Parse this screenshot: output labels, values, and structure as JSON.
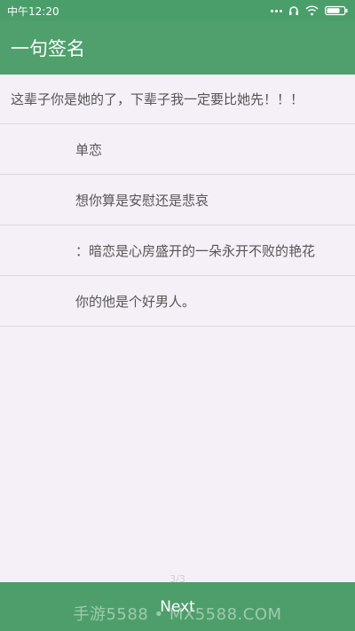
{
  "status_bar": {
    "time": "中午12:20",
    "icons": [
      "more-dots-icon",
      "headphones-icon",
      "wifi-icon",
      "battery-icon"
    ]
  },
  "app_bar": {
    "title": "一句签名"
  },
  "list": {
    "items": [
      "这辈子你是她的了，下辈子我一定要比她先！！！",
      "单恋",
      "想你算是安慰还是悲哀",
      "：暗恋是心房盛开的一朵永开不败的艳花",
      "你的他是个好男人。"
    ]
  },
  "pager": {
    "text": "3/3"
  },
  "bottom_bar": {
    "next_label": "Next"
  },
  "watermark": {
    "text": "手游5588 • MX5588.COM"
  },
  "colors": {
    "primary": "#4fa06d",
    "background": "#f5eff7",
    "divider": "#dcd6de",
    "text": "#555555"
  }
}
